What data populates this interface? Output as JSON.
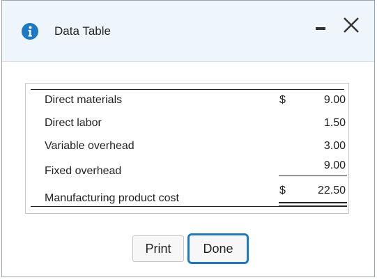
{
  "dialog": {
    "title": "Data Table",
    "icons": {
      "info": "info-icon",
      "minimize": "minimize-icon",
      "close": "close-icon"
    },
    "colors": {
      "header_bg": "#eef5fb",
      "info_icon": "#1c7ac4",
      "focus_ring": "#1c7ac4"
    }
  },
  "table": {
    "rows": [
      {
        "label": "Direct materials",
        "dollar": "$",
        "amount": "9.00"
      },
      {
        "label": "Direct labor",
        "dollar": "",
        "amount": "1.50"
      },
      {
        "label": "Variable overhead",
        "dollar": "",
        "amount": "3.00"
      },
      {
        "label": "Fixed overhead",
        "dollar": "",
        "amount": "9.00"
      }
    ],
    "total": {
      "label": "Manufacturing product cost",
      "dollar": "$",
      "amount": "22.50"
    }
  },
  "buttons": {
    "print_label": "Print",
    "done_label": "Done"
  }
}
